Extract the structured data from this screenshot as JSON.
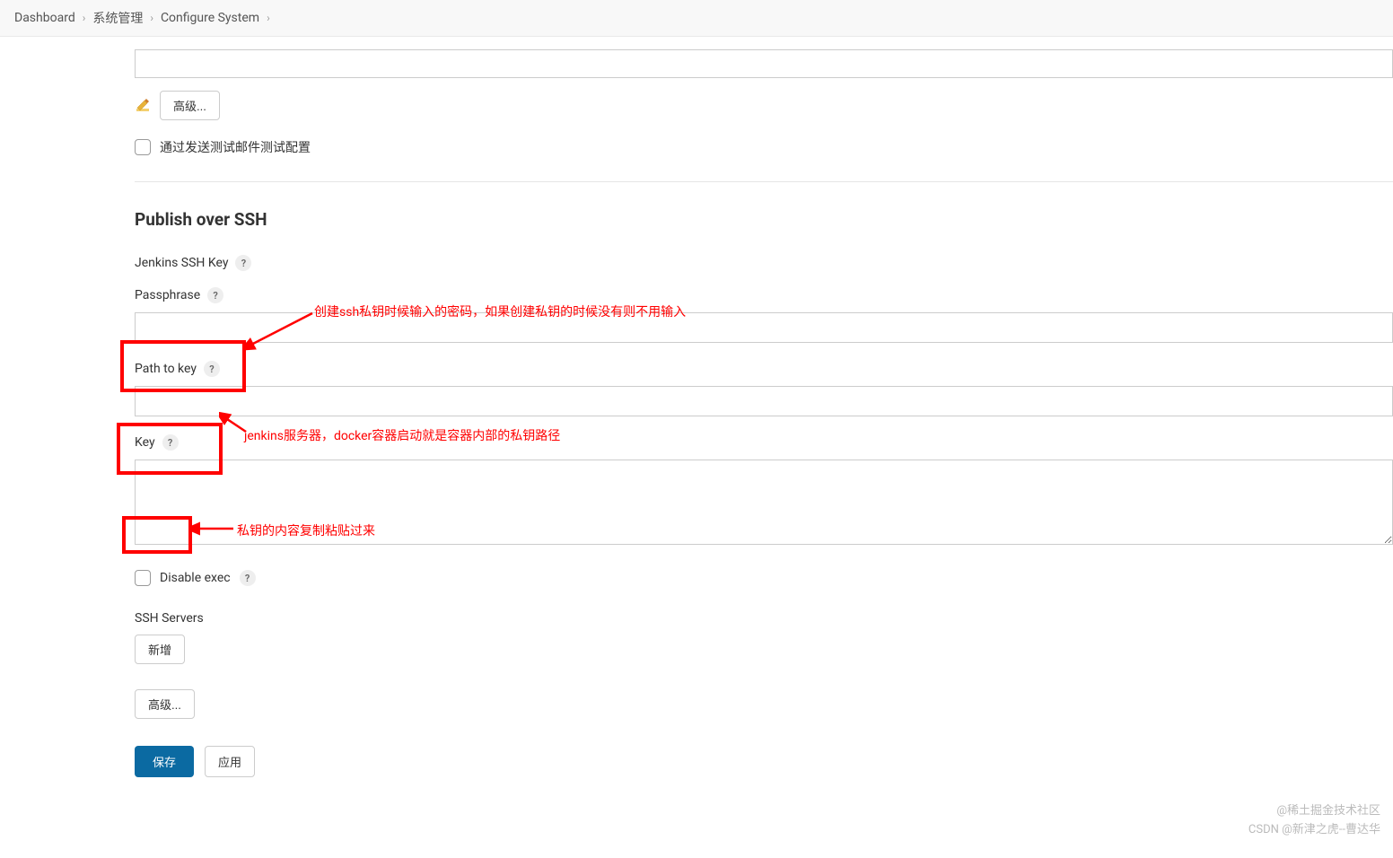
{
  "breadcrumb": {
    "items": [
      "Dashboard",
      "系统管理",
      "Configure System"
    ]
  },
  "top_section": {
    "advanced_button": "高级...",
    "test_email_checkbox_label": "通过发送测试邮件测试配置"
  },
  "ssh_section": {
    "title": "Publish over SSH",
    "jenkins_ssh_key_label": "Jenkins SSH Key",
    "passphrase": {
      "label": "Passphrase",
      "value": ""
    },
    "path_to_key": {
      "label": "Path to key",
      "value": ""
    },
    "key": {
      "label": "Key",
      "value": ""
    },
    "disable_exec_label": "Disable exec",
    "ssh_servers_label": "SSH Servers",
    "add_button": "新增",
    "advanced_button": "高级..."
  },
  "annotations": {
    "passphrase_note": "创建ssh私钥时候输入的密码，如果创建私钥的时候没有则不用输入",
    "path_note": "jenkins服务器，docker容器启动就是容器内部的私钥路径",
    "key_note": "私钥的内容复制粘贴过来"
  },
  "footer": {
    "save": "保存",
    "apply": "应用"
  },
  "watermark": {
    "line1": "@稀土掘金技术社区",
    "line2": "CSDN @新津之虎--曹达华"
  }
}
